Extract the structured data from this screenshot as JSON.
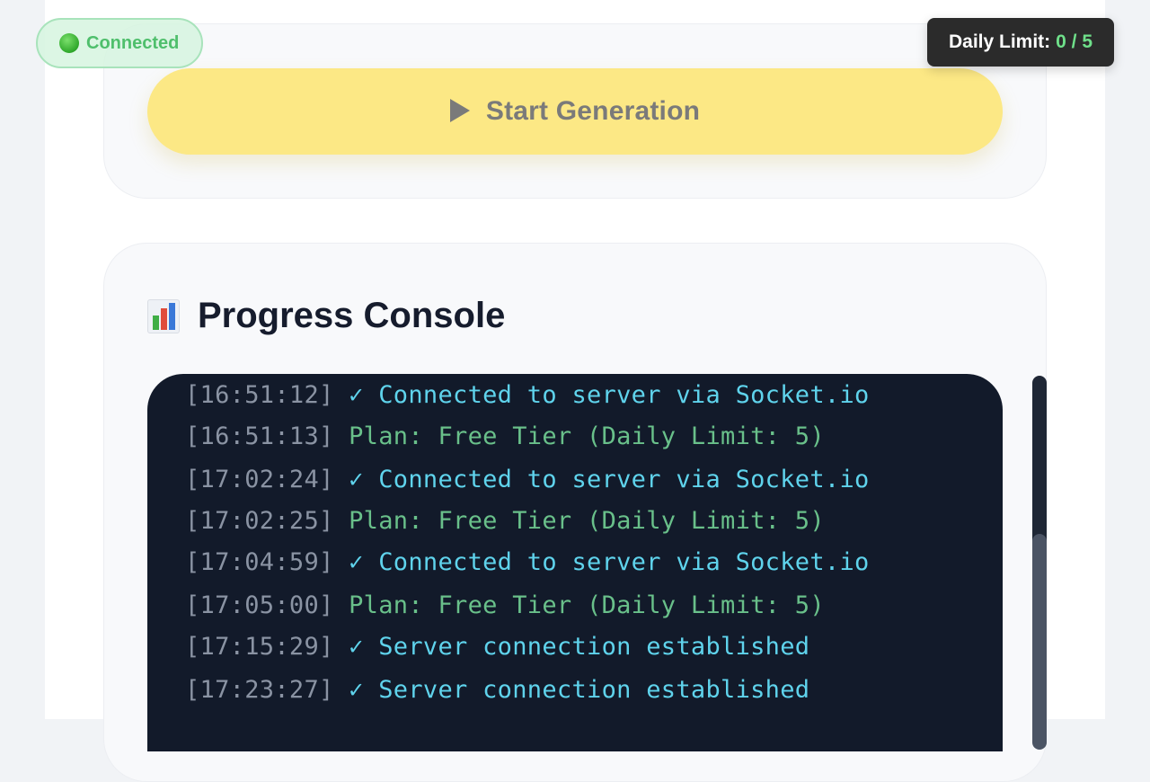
{
  "status": {
    "label": "Connected",
    "color": "#4fbf6c"
  },
  "daily_limit": {
    "label": "Daily Limit:",
    "value": "0 / 5"
  },
  "generation": {
    "start_label": "Start Generation",
    "icon": "play-icon"
  },
  "console": {
    "title": "Progress Console",
    "icon": "bar-chart-icon",
    "lines": [
      {
        "time": "[16:51:12]",
        "message": "✓ Connected to server via Socket.io",
        "kind": "info"
      },
      {
        "time": "[16:51:13]",
        "message": "Plan: Free Tier (Daily Limit: 5)",
        "kind": "plan"
      },
      {
        "time": "[17:02:24]",
        "message": "✓ Connected to server via Socket.io",
        "kind": "info"
      },
      {
        "time": "[17:02:25]",
        "message": "Plan: Free Tier (Daily Limit: 5)",
        "kind": "plan"
      },
      {
        "time": "[17:04:59]",
        "message": "✓ Connected to server via Socket.io",
        "kind": "info"
      },
      {
        "time": "[17:05:00]",
        "message": "Plan: Free Tier (Daily Limit: 5)",
        "kind": "plan"
      },
      {
        "time": "[17:15:29]",
        "message": "✓ Server connection established",
        "kind": "info"
      },
      {
        "time": "[17:23:27]",
        "message": "✓ Server connection established",
        "kind": "info"
      }
    ]
  },
  "colors": {
    "accent_button": "#fce885",
    "terminal_bg": "#121a2a",
    "info_text": "#5fd3ec",
    "plan_text": "#69c08a",
    "timestamp_text": "#8a93a3"
  }
}
